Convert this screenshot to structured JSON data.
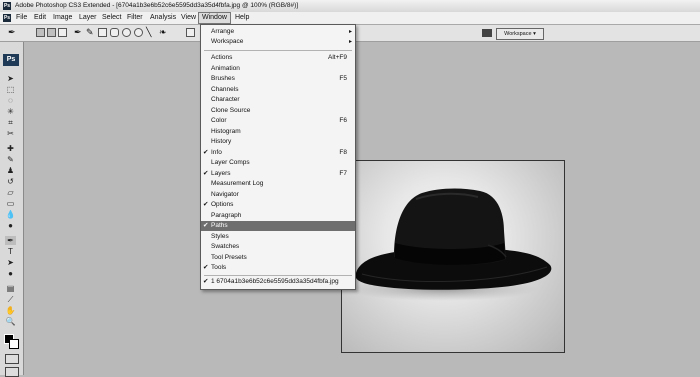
{
  "titlebar": {
    "app_icon": "Ps",
    "title": "Adobe Photoshop CS3 Extended - [6704a1b3e6b52c6e5595dd3a35d4fbfa.jpg @ 100% (RGB/8#)]"
  },
  "menubar": {
    "app_icon": "Ps",
    "items": [
      "File",
      "Edit",
      "Image",
      "Layer",
      "Select",
      "Filter",
      "Analysis",
      "View",
      "Window",
      "Help"
    ]
  },
  "options_bar": {
    "workspace_label": "Workspace ▾"
  },
  "toolbox": {
    "logo": "Ps"
  },
  "window_menu": {
    "items": [
      {
        "label": "Arrange",
        "shortcut": "",
        "check": "",
        "submenu": "▸"
      },
      {
        "label": "Workspace",
        "shortcut": "",
        "check": "",
        "submenu": "▸"
      },
      {
        "label": "Actions",
        "shortcut": "Alt+F9",
        "check": "",
        "submenu": ""
      },
      {
        "label": "Animation",
        "shortcut": "",
        "check": "",
        "submenu": ""
      },
      {
        "label": "Brushes",
        "shortcut": "F5",
        "check": "",
        "submenu": ""
      },
      {
        "label": "Channels",
        "shortcut": "",
        "check": "",
        "submenu": ""
      },
      {
        "label": "Character",
        "shortcut": "",
        "check": "",
        "submenu": ""
      },
      {
        "label": "Clone Source",
        "shortcut": "",
        "check": "",
        "submenu": ""
      },
      {
        "label": "Color",
        "shortcut": "F6",
        "check": "",
        "submenu": ""
      },
      {
        "label": "Histogram",
        "shortcut": "",
        "check": "",
        "submenu": ""
      },
      {
        "label": "History",
        "shortcut": "",
        "check": "",
        "submenu": ""
      },
      {
        "label": "Info",
        "shortcut": "F8",
        "check": "✔",
        "submenu": ""
      },
      {
        "label": "Layer Comps",
        "shortcut": "",
        "check": "",
        "submenu": ""
      },
      {
        "label": "Layers",
        "shortcut": "F7",
        "check": "✔",
        "submenu": ""
      },
      {
        "label": "Measurement Log",
        "shortcut": "",
        "check": "",
        "submenu": ""
      },
      {
        "label": "Navigator",
        "shortcut": "",
        "check": "",
        "submenu": ""
      },
      {
        "label": "Options",
        "shortcut": "",
        "check": "✔",
        "submenu": ""
      },
      {
        "label": "Paragraph",
        "shortcut": "",
        "check": "",
        "submenu": ""
      },
      {
        "label": "Paths",
        "shortcut": "",
        "check": "✔",
        "submenu": ""
      },
      {
        "label": "Styles",
        "shortcut": "",
        "check": "",
        "submenu": ""
      },
      {
        "label": "Swatches",
        "shortcut": "",
        "check": "",
        "submenu": ""
      },
      {
        "label": "Tool Presets",
        "shortcut": "",
        "check": "",
        "submenu": ""
      },
      {
        "label": "Tools",
        "shortcut": "",
        "check": "✔",
        "submenu": ""
      },
      {
        "label": "1 6704a1b3e6b52c6e5595dd3a35d4fbfa.jpg",
        "shortcut": "",
        "check": "✔",
        "submenu": ""
      }
    ],
    "highlighted": "Paths"
  },
  "colors": {
    "menu_highlight": "#6e6e6e",
    "workspace_bg": "#b9b9b9"
  }
}
